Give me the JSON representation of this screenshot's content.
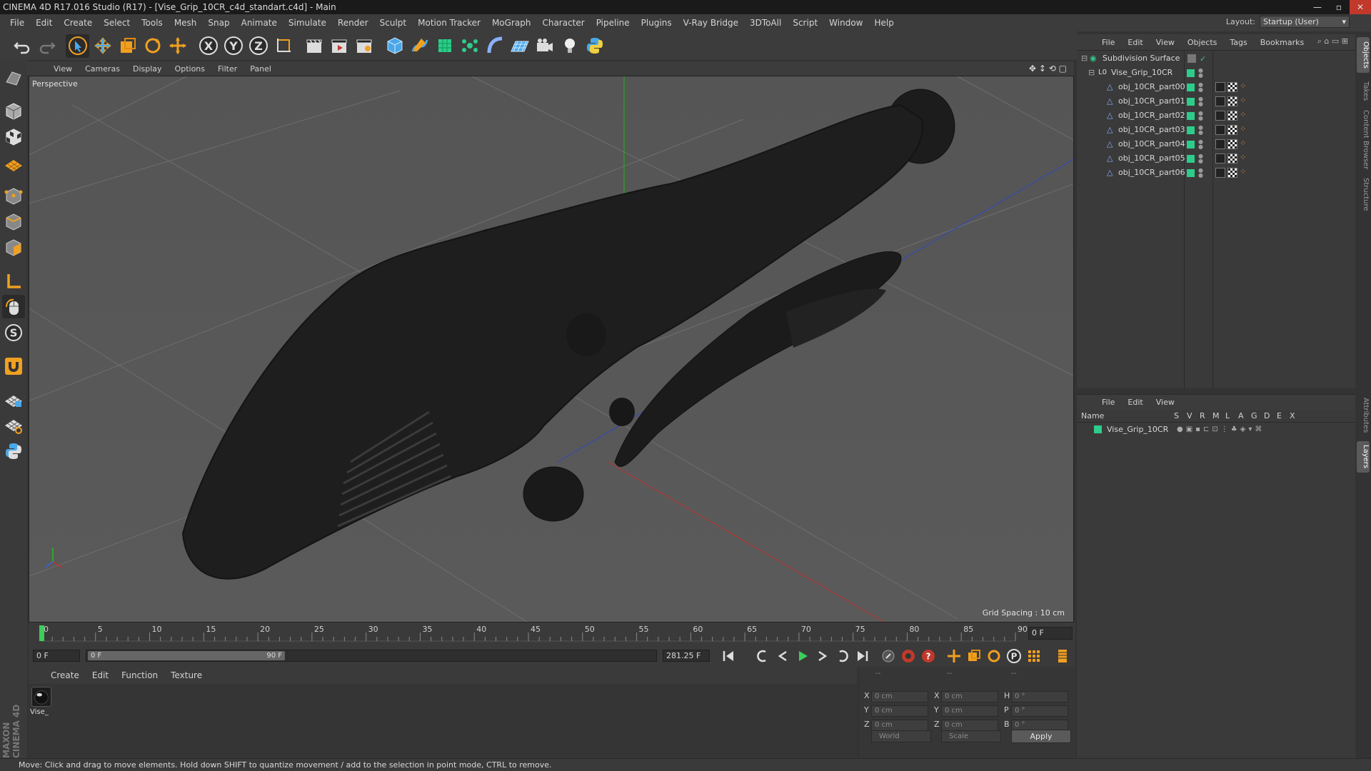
{
  "window": {
    "title": "CINEMA 4D R17.016 Studio (R17) - [Vise_Grip_10CR_c4d_standart.c4d] - Main",
    "buttons": [
      "—",
      "▫",
      "✕"
    ]
  },
  "menu": [
    "File",
    "Edit",
    "Create",
    "Select",
    "Tools",
    "Mesh",
    "Snap",
    "Animate",
    "Simulate",
    "Render",
    "Sculpt",
    "Motion Tracker",
    "MoGraph",
    "Character",
    "Pipeline",
    "Plugins",
    "V-Ray Bridge",
    "3DToAll",
    "Script",
    "Window",
    "Help"
  ],
  "layout": {
    "label": "Layout:",
    "value": "Startup (User)"
  },
  "viewport": {
    "menu": [
      "View",
      "Cameras",
      "Display",
      "Options",
      "Filter",
      "Panel"
    ],
    "label": "Perspective",
    "grid_spacing": "Grid Spacing : 10 cm",
    "nav_icons": "✥ ↕ ⟲ ▢"
  },
  "timeline": {
    "ticks": [
      "0",
      "5",
      "10",
      "15",
      "20",
      "25",
      "30",
      "35",
      "40",
      "45",
      "50",
      "55",
      "60",
      "65",
      "70",
      "75",
      "80",
      "85",
      "90"
    ],
    "current_frame_field": "0 F"
  },
  "transport": {
    "start_field": "0 F",
    "range_start": "0 F",
    "range_end": "90 F",
    "end_field": "281.25 F"
  },
  "material_manager": {
    "menu": [
      "Create",
      "Edit",
      "Function",
      "Texture"
    ],
    "materials": [
      {
        "name": "Vise_"
      }
    ]
  },
  "coordinates": {
    "header": [
      "--",
      "--",
      "--"
    ],
    "rows": [
      {
        "a": "X",
        "av": "0 cm",
        "b": "X",
        "bv": "0 cm",
        "c": "H",
        "cv": "0 °"
      },
      {
        "a": "Y",
        "av": "0 cm",
        "b": "Y",
        "bv": "0 cm",
        "c": "P",
        "cv": "0 °"
      },
      {
        "a": "Z",
        "av": "0 cm",
        "b": "Z",
        "bv": "0 cm",
        "c": "B",
        "cv": "0 °"
      }
    ],
    "mode": "World",
    "transform": "Scale",
    "apply": "Apply"
  },
  "object_manager": {
    "menu": [
      "File",
      "Edit",
      "View",
      "Objects",
      "Tags",
      "Bookmarks"
    ],
    "objects": [
      {
        "name": "Subdivision Surface",
        "level": 0
      },
      {
        "name": "Vise_Grip_10CR",
        "level": 1
      },
      {
        "name": "obj_10CR_part00",
        "level": 2
      },
      {
        "name": "obj_10CR_part01",
        "level": 2
      },
      {
        "name": "obj_10CR_part02",
        "level": 2
      },
      {
        "name": "obj_10CR_part03",
        "level": 2
      },
      {
        "name": "obj_10CR_part04",
        "level": 2
      },
      {
        "name": "obj_10CR_part05",
        "level": 2
      },
      {
        "name": "obj_10CR_part06",
        "level": 2
      }
    ]
  },
  "layer_manager": {
    "menu": [
      "File",
      "Edit",
      "View"
    ],
    "columns": [
      "Name",
      "S",
      "V",
      "R",
      "M",
      "L",
      "A",
      "G",
      "D",
      "E",
      "X"
    ],
    "layers": [
      {
        "name": "Vise_Grip_10CR"
      }
    ]
  },
  "right_tabs": [
    "Objects",
    "Takes",
    "Content Browser",
    "Structure",
    "Attributes",
    "Layers"
  ],
  "status": "Move: Click and drag to move elements. Hold down SHIFT to quantize movement / add to the selection in point mode, CTRL to remove.",
  "brand": "MAXON CINEMA 4D",
  "colors": {
    "accent_green": "#2ecc8a",
    "tool_orange": "#f0a020",
    "tool_blue": "#4aa8e8"
  }
}
